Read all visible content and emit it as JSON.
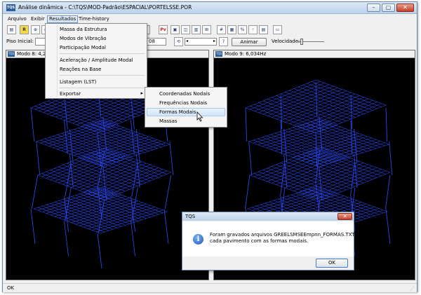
{
  "window": {
    "app_icon_text": "TQS",
    "title": "Análise dinâmica - C:\\TQS\\MOD-Padrão\\ESPACIAL\\PORTELSSE.POR",
    "min_glyph": "–",
    "max_glyph": "▢",
    "close_glyph": "✕"
  },
  "menubar": {
    "items": [
      "Arquivo",
      "Exibir",
      "Resultados",
      "Time-history"
    ]
  },
  "toolbar": {
    "pv_label": "Pv",
    "r_label": "R"
  },
  "controls": {
    "piso_label": "Piso Inicial:",
    "piso_value": "",
    "frame_value": "08",
    "animar_label": "Animar",
    "velocidade_label": "Velocidade:"
  },
  "panes": {
    "left_title": "Modo 8: 4,28",
    "left_icon": "TQS",
    "right_title": "Modo 9: 6,034Hz",
    "right_icon": "TQS"
  },
  "results_menu": {
    "items": [
      "Massa da Estrutura",
      "Modos de Vibração",
      "Participação Modal",
      "Aceleração / Amplitude Modal",
      "Reações na Base",
      "Listagem (LST)",
      "Exportar"
    ],
    "submenu_arrow": "▸"
  },
  "export_submenu": {
    "items": [
      "Coordenadas Nodais",
      "Frequências Nodais",
      "Formas Modais",
      "Massas"
    ],
    "highlighted": "Formas Modais"
  },
  "dialog": {
    "title": "TQS",
    "message_line1": "Foram gravados arquivos GREELSMSEEmpnn_FORMAS.TXT em",
    "message_line2": "cada pavimento com as formas modais.",
    "ok_label": "OK",
    "close_glyph": "✕",
    "icon_glyph": "i"
  },
  "status": {
    "text": "OK"
  },
  "colors": {
    "mesh": "#2a46e6",
    "canvas": "#000000"
  }
}
